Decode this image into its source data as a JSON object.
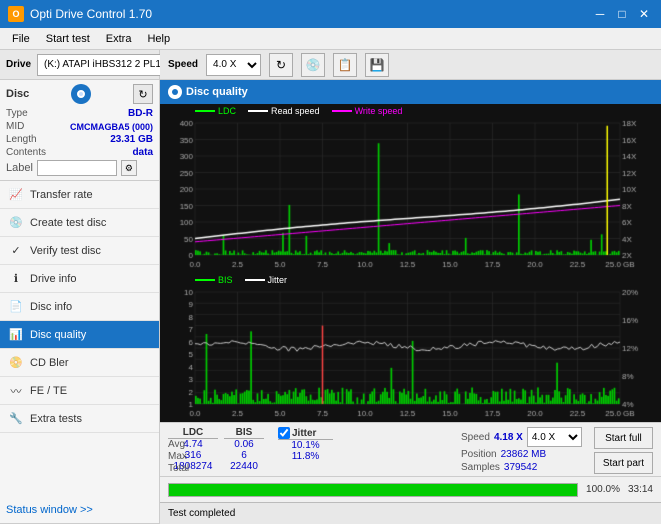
{
  "titleBar": {
    "title": "Opti Drive Control 1.70",
    "minBtn": "─",
    "maxBtn": "□",
    "closeBtn": "✕"
  },
  "menuBar": {
    "items": [
      "File",
      "Start test",
      "Extra",
      "Help"
    ]
  },
  "header": {
    "driveLabel": "Drive",
    "driveValue": "(K:)  ATAPI iHBS312  2 PL17",
    "speedLabel": "Speed",
    "speedValue": "4.0 X"
  },
  "disc": {
    "type": "BD-R",
    "mid": "CMCMAGBA5 (000)",
    "length": "23.31 GB",
    "contents": "data",
    "labelPlaceholder": ""
  },
  "nav": {
    "items": [
      {
        "id": "transfer-rate",
        "label": "Transfer rate",
        "icon": "chart"
      },
      {
        "id": "create-test-disc",
        "label": "Create test disc",
        "icon": "disc"
      },
      {
        "id": "verify-test-disc",
        "label": "Verify test disc",
        "icon": "check"
      },
      {
        "id": "drive-info",
        "label": "Drive info",
        "icon": "info"
      },
      {
        "id": "disc-info",
        "label": "Disc info",
        "icon": "disc-info"
      },
      {
        "id": "disc-quality",
        "label": "Disc quality",
        "icon": "quality",
        "active": true
      },
      {
        "id": "cd-bler",
        "label": "CD Bler",
        "icon": "cd"
      },
      {
        "id": "fe-te",
        "label": "FE / TE",
        "icon": "fe"
      },
      {
        "id": "extra-tests",
        "label": "Extra tests",
        "icon": "extra"
      }
    ]
  },
  "discQuality": {
    "title": "Disc quality",
    "topChart": {
      "legend": [
        {
          "label": "LDC",
          "color": "#00ff00"
        },
        {
          "label": "Read speed",
          "color": "#ffffff"
        },
        {
          "label": "Write speed",
          "color": "#ff00ff"
        }
      ],
      "yAxisRight": [
        "18X",
        "16X",
        "14X",
        "12X",
        "10X",
        "8X",
        "6X",
        "4X",
        "2X"
      ],
      "yAxisLeft": [
        "400",
        "350",
        "300",
        "250",
        "200",
        "150",
        "100",
        "50"
      ],
      "xAxis": [
        "0.0",
        "2.5",
        "5.0",
        "7.5",
        "10.0",
        "12.5",
        "15.0",
        "17.5",
        "20.0",
        "22.5",
        "25.0 GB"
      ]
    },
    "bottomChart": {
      "legend": [
        {
          "label": "BIS",
          "color": "#00ff00"
        },
        {
          "label": "Jitter",
          "color": "#ffffff"
        }
      ],
      "yAxisRight": [
        "20%",
        "16%",
        "12%",
        "8%",
        "4%"
      ],
      "yAxisLeft": [
        "10",
        "9",
        "8",
        "7",
        "6",
        "5",
        "4",
        "3",
        "2",
        "1"
      ],
      "xAxis": [
        "0.0",
        "2.5",
        "5.0",
        "7.5",
        "10.0",
        "12.5",
        "15.0",
        "17.5",
        "20.0",
        "22.5",
        "25.0 GB"
      ]
    }
  },
  "stats": {
    "ldcLabel": "LDC",
    "bisLabel": "BIS",
    "jitterLabel": "Jitter",
    "jitterChecked": true,
    "speedLabel": "Speed",
    "speedValue": "4.18 X",
    "speedDropdown": "4.0 X",
    "rows": [
      {
        "label": "Avg",
        "ldc": "4.74",
        "bis": "0.06",
        "jitter": "10.1%"
      },
      {
        "label": "Max",
        "ldc": "316",
        "bis": "6",
        "jitter": "11.8%"
      },
      {
        "label": "Total",
        "ldc": "1808274",
        "bis": "22440",
        "jitter": ""
      }
    ],
    "positionLabel": "Position",
    "positionValue": "23862 MB",
    "samplesLabel": "Samples",
    "samplesValue": "379542",
    "startFullBtn": "Start full",
    "startPartBtn": "Start part"
  },
  "bottomBar": {
    "statusNavLabel": "Status window >>",
    "progressValue": 100,
    "progressText": "100.0%",
    "timeText": "33:14"
  },
  "statusBar": {
    "text": "Test completed"
  }
}
